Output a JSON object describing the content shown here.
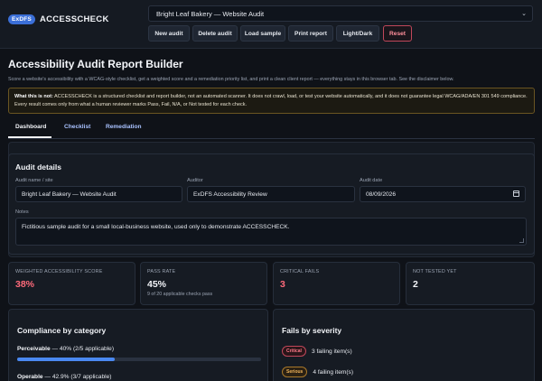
{
  "brand": {
    "badge": "ExDFS",
    "name": "ACCESSCHECK"
  },
  "audit_select": {
    "selected": "Bright Leaf Bakery — Website Audit"
  },
  "toolbar": {
    "new_audit": "New audit",
    "delete_audit": "Delete audit",
    "load_sample": "Load sample",
    "print_report": "Print report",
    "light_dark": "Light/Dark",
    "reset": "Reset"
  },
  "page": {
    "title": "Accessibility Audit Report Builder",
    "subtitle": "Score a website's accessibility with a WCAG-style checklist, get a weighted score and a remediation priority list, and print a clean client report — everything stays in this browser tab. See the disclaimer below."
  },
  "disclaimer": {
    "lead": "What this is not:",
    "text": " ACCESSCHECK is a structured checklist and report builder, not an automated scanner. It does not crawl, load, or test your website automatically, and it does not guarantee legal WCAG/ADA/EN 301 549 compliance. Every result comes only from what a human reviewer marks Pass, Fail, N/A, or Not tested for each check."
  },
  "tabs": [
    "Dashboard",
    "Checklist",
    "Remediation"
  ],
  "audit_details": {
    "heading": "Audit details",
    "name_label": "Audit name / site",
    "name_value": "Bright Leaf Bakery — Website Audit",
    "auditor_label": "Auditor",
    "auditor_value": "ExDFS Accessibility Review",
    "date_label": "Audit date",
    "date_value": "08/09/2026",
    "notes_label": "Notes",
    "notes_value": "Fictitious sample audit for a small local-business website, used only to demonstrate ACCESSCHECK."
  },
  "stats": {
    "weighted": {
      "label": "WEIGHTED ACCESSIBILITY SCORE",
      "value": "38%"
    },
    "pass_rate": {
      "label": "PASS RATE",
      "value": "45%",
      "sub": "9 of 20 applicable checks pass"
    },
    "critical": {
      "label": "CRITICAL FAILS",
      "value": "3"
    },
    "not_tested": {
      "label": "NOT TESTED YET",
      "value": "2"
    }
  },
  "compliance": {
    "heading": "Compliance by category",
    "rows": [
      {
        "name": "Perceivable",
        "detail": " — 40% (2/5 applicable)",
        "fraction": 0.4
      },
      {
        "name": "Operable",
        "detail": " — 42.9% (3/7 applicable)",
        "fraction": 0.429
      }
    ]
  },
  "severity": {
    "heading": "Fails by severity",
    "rows": [
      {
        "badge": "Critical",
        "text": "3 failing item(s)"
      },
      {
        "badge": "Serious",
        "text": "4 failing item(s)"
      }
    ]
  },
  "colors": {
    "accent": "#4a88f0",
    "danger": "#ff6a7a",
    "warning_border": "#6a5522"
  }
}
